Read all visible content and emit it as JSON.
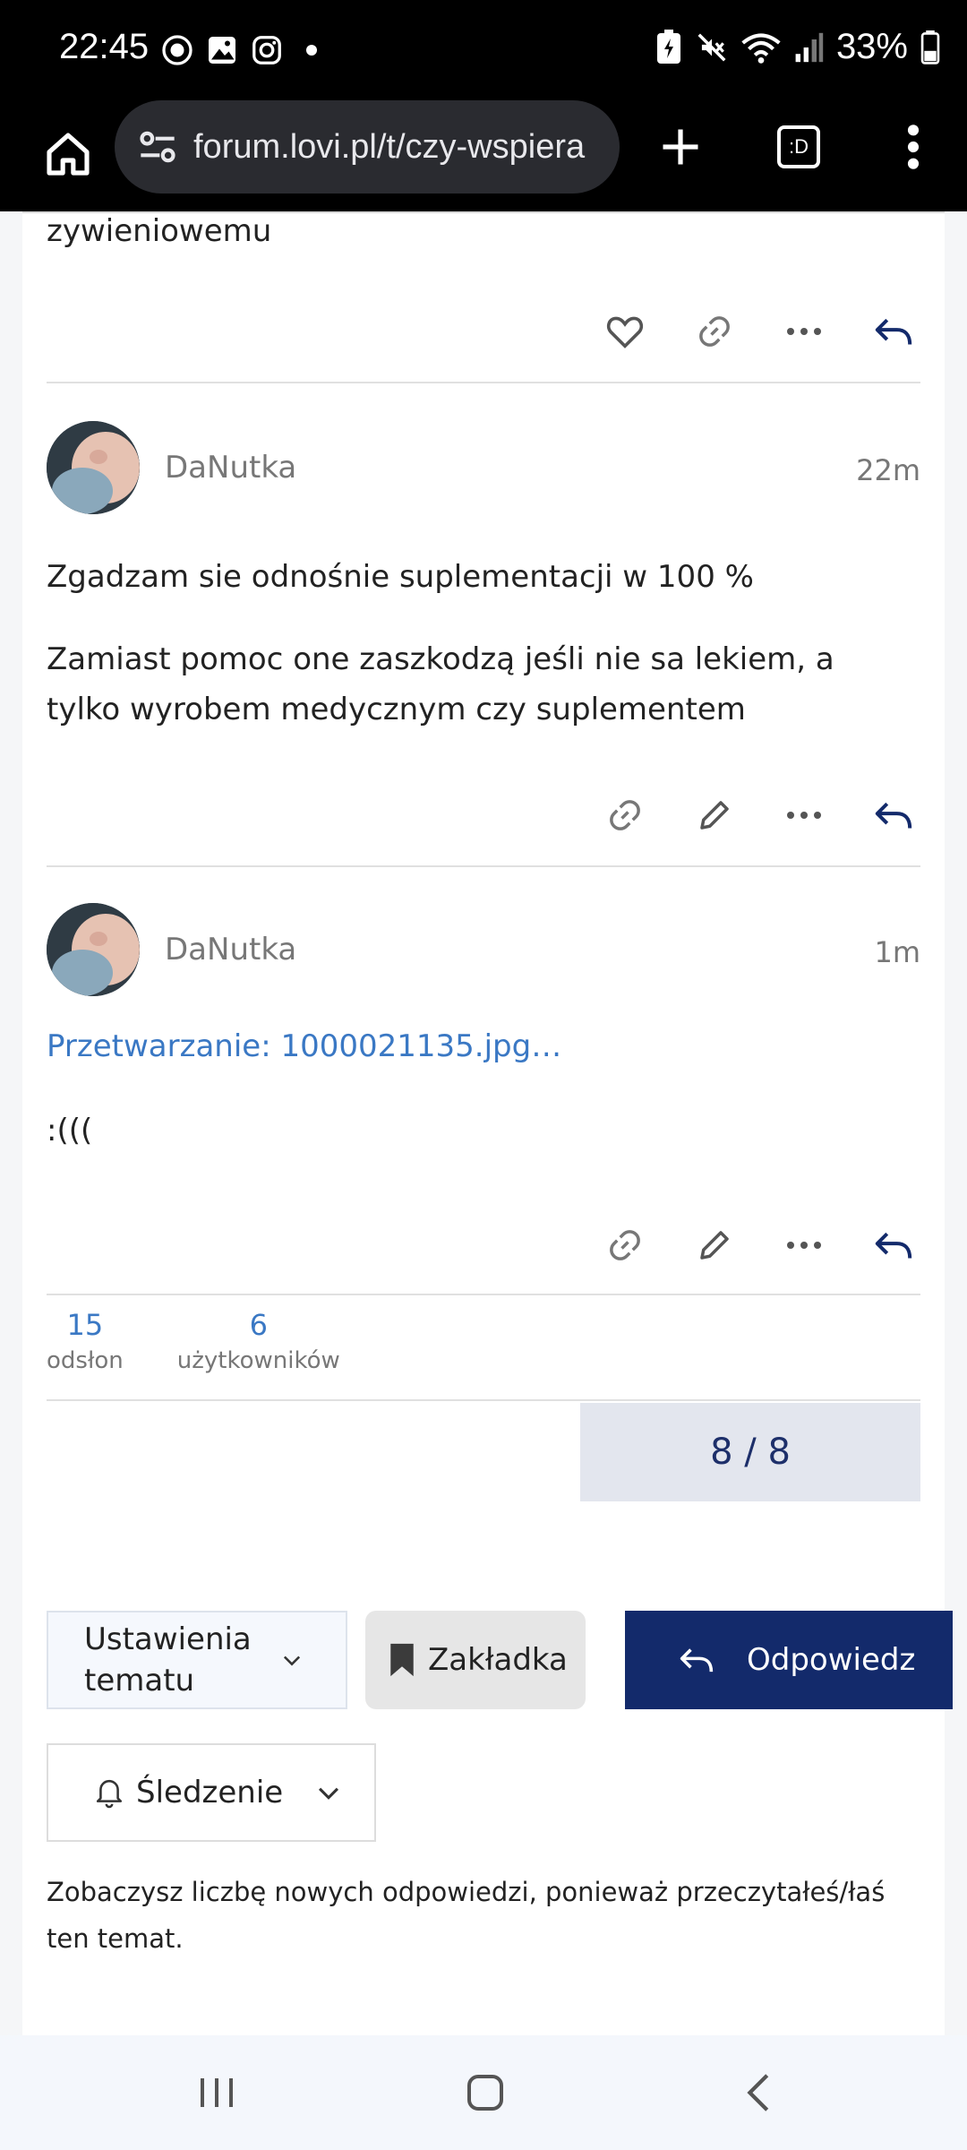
{
  "status_bar": {
    "time": "22:45",
    "battery": "33%",
    "icons_left": [
      "record-icon",
      "gallery-icon",
      "instagram-icon",
      "dot-icon"
    ],
    "icons_right": [
      "battery-saver-icon",
      "mute-icon",
      "wifi-icon",
      "signal-icon",
      "battery-icon"
    ]
  },
  "browser": {
    "url": "forum.lovi.pl/t/czy-wspiera",
    "tab_count_label": ":D"
  },
  "top_fragment": {
    "text": "zywieniowemu"
  },
  "posts": [
    {
      "username": "DaNutka",
      "time": "22m",
      "paragraphs": [
        "Zgadzam sie odnośnie suplementacji w 100 %",
        "Zamiast pomoc one zaszkodzą jeśli nie sa lekiem, a tylko wyrobem medycznym czy suplementem"
      ]
    },
    {
      "username": "DaNutka",
      "time": "1m",
      "link": "Przetwarzanie: 1000021135.jpg…",
      "text": ":((("
    }
  ],
  "stats": {
    "views_count": "15",
    "views_label": "odsłon",
    "users_count": "6",
    "users_label": "użytkowników"
  },
  "progress": {
    "label": "8 / 8"
  },
  "controls": {
    "topic_settings": "Ustawienia tematu",
    "bookmark": "Zakładka",
    "reply": "Odpowiedz",
    "tracking": "Śledzenie"
  },
  "note": "Zobaczysz liczbę nowych odpowiedzi, ponieważ przeczytałeś/łaś ten temat.",
  "colors": {
    "accent": "#132a6b",
    "link": "#3a78c4"
  }
}
